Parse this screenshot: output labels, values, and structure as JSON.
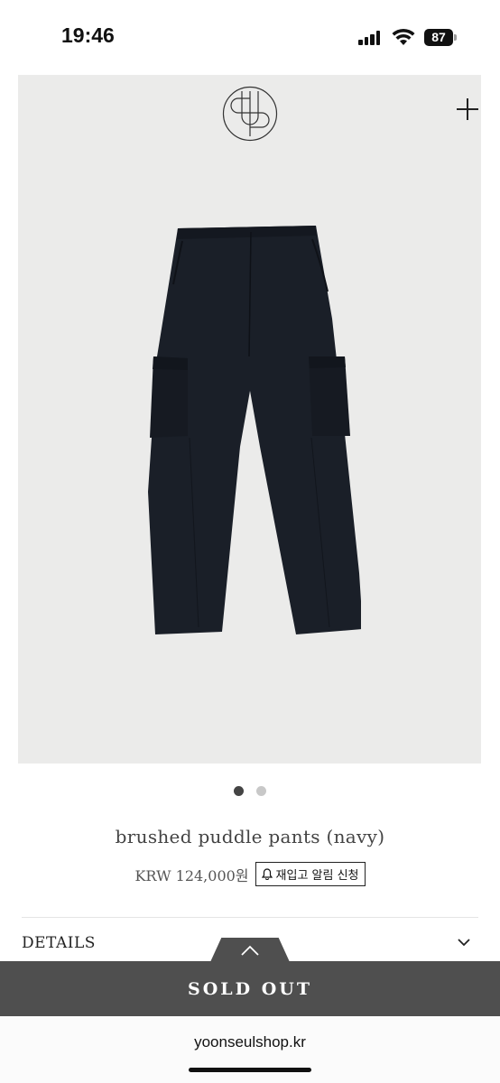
{
  "status_bar": {
    "time": "19:46",
    "battery": "87"
  },
  "hero": {
    "logo_icon": "brand-monogram-icon",
    "plus_icon": "plus-icon",
    "image": "navy-cargo-pants-photo",
    "background_color": "#ebebea",
    "garment_color": "#1a1f28"
  },
  "carousel": {
    "total": 2,
    "active_index": 0
  },
  "product": {
    "name": "brushed puddle pants (navy)",
    "price": "KRW 124,000원",
    "restock_label": "재입고 알림 신청",
    "restock_icon": "bell-icon"
  },
  "details": {
    "label": "DETAILS",
    "icon": "chevron-down-icon"
  },
  "purchase": {
    "soldout_label": "SOLD OUT",
    "bar_color": "#4f4f4f",
    "expand_icon": "chevron-up-icon"
  },
  "browser": {
    "url": "yoonseulshop.kr"
  }
}
